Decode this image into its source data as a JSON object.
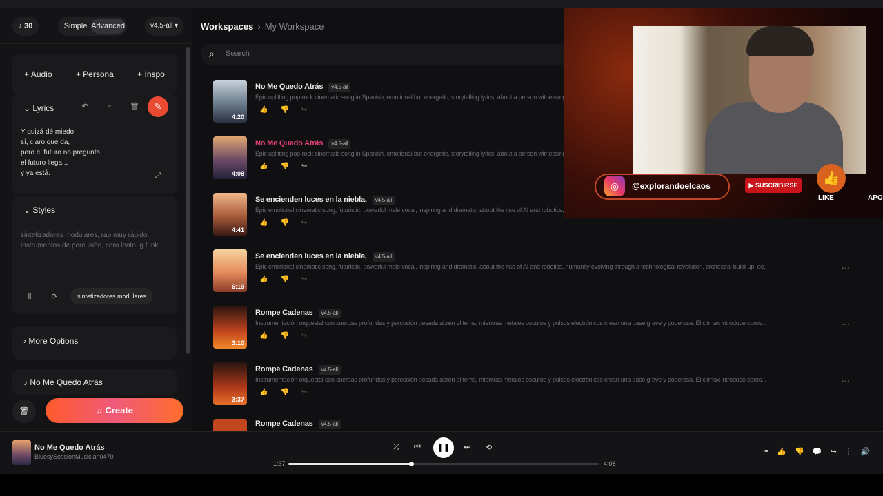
{
  "sidebar": {
    "credits": "30",
    "mode_simple": "Simple",
    "mode_advanced": "Advanced",
    "model": "v4.5-all",
    "add_audio": "Audio",
    "add_persona": "Persona",
    "add_inspo": "Inspo",
    "lyrics_title": "Lyrics",
    "lyrics_text": "Y quizá dé miedo,\nsí, claro que da,\npero el futuro no pregunta,\nel futuro llega...\ny ya está.",
    "styles_title": "Styles",
    "styles_text": "sintetizadores modulares, rap muy rápido, instrumentos de percusión, coro lento, g funk",
    "style_chip": "sintetizadores modulares",
    "more_options": "More Options",
    "selected_song": "No Me Quedo Atrás",
    "create_label": "Create"
  },
  "main": {
    "crumb_root": "Workspaces",
    "crumb_current": "My Workspace",
    "search_placeholder": "Search",
    "songs": [
      {
        "title": "No Me Quedo Atrás",
        "version": "v4.5-all",
        "duration": "4:20",
        "desc": "Epic uplifting pop-rock cinematic song in Spanish, emotional but energetic, storytelling lyrics, about a person witnessing..."
      },
      {
        "title": "No Me Quedo Atrás",
        "version": "v4.5-all",
        "duration": "4:08",
        "desc": "Epic uplifting pop-rock cinematic song in Spanish, emotional but energetic, storytelling lyrics, about a person witnessing..."
      },
      {
        "title": "Se encienden luces en la niebla,",
        "version": "v4.5-all",
        "duration": "4:41",
        "desc": "Epic emotional cinematic song, futuristic, powerful male vocal, inspiring and dramatic, about the rise of AI and robotics, humanity evolving through a technological revolution, orchestral build-up, de..."
      },
      {
        "title": "Se encienden luces en la niebla,",
        "version": "v4.5-all",
        "duration": "6:19",
        "desc": "Epic emotional cinematic song, futuristic, powerful male vocal, inspiring and dramatic, about the rise of AI and robotics, humanity evolving through a technological revolution, orchestral build-up, de..."
      },
      {
        "title": "Rompe Cadenas",
        "version": "v4.5-all",
        "duration": "3:10",
        "desc": "Instrumentación orquestal con cuerdas profundas y percusión pesada abren el tema, mientras metales oscuros y pulsos electrónicos crean una base grave y poderosa. El clímax introduce coros..."
      },
      {
        "title": "Rompe Cadenas",
        "version": "v4.5-all",
        "duration": "3:37",
        "desc": "Instrumentación orquestal con cuerdas profundas y percusión pesada abren el tema, mientras metales oscuros y pulsos electrónicos crean una base grave y poderosa. El clímax introduce coros..."
      },
      {
        "title": "Rompe Cadenas",
        "version": "v4.5-all",
        "duration": "",
        "desc": ""
      }
    ]
  },
  "overlay": {
    "instagram_handle": "@explorandoelcaos",
    "subscribe": "SUSCRIBIRSE",
    "like": "LIKE",
    "apo": "APO"
  },
  "player": {
    "title": "No Me Quedo Atrás",
    "artist": "BluesySessionMusician0470",
    "current_time": "1:37",
    "total_time": "4:08",
    "progress": 0.395
  },
  "colors": {
    "accent": "#e94a31",
    "playing_title": "#e8407a"
  }
}
